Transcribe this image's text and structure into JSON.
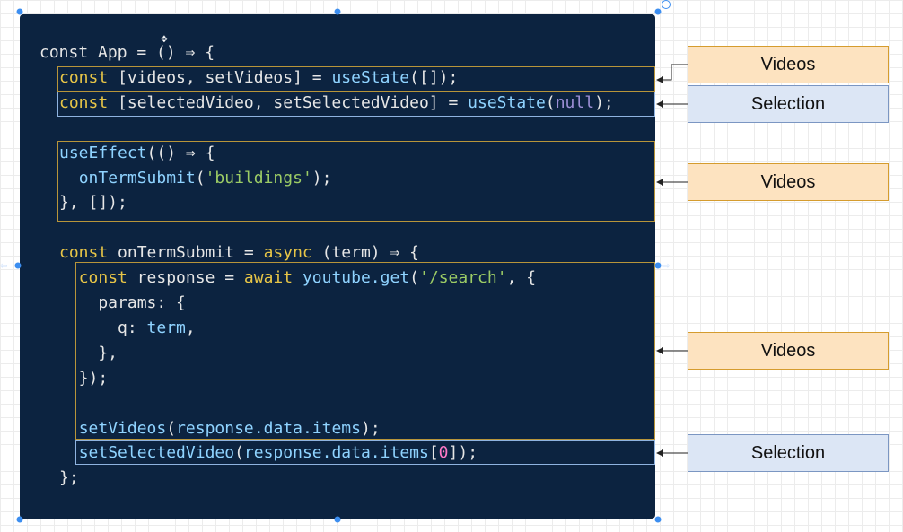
{
  "code": {
    "lines": [
      [
        {
          "t": "const App = () ⇒ {",
          "c": ""
        }
      ],
      [
        {
          "t": "const",
          "c": "kw"
        },
        {
          "t": " [videos, setVideos] = ",
          "c": ""
        },
        {
          "t": "useState",
          "c": "fn"
        },
        {
          "t": "([]);",
          "c": ""
        }
      ],
      [
        {
          "t": "const",
          "c": "kw"
        },
        {
          "t": " [selectedVideo, setSelectedVideo] = ",
          "c": ""
        },
        {
          "t": "useState",
          "c": "fn"
        },
        {
          "t": "(",
          "c": ""
        },
        {
          "t": "null",
          "c": "nul"
        },
        {
          "t": ");",
          "c": ""
        }
      ],
      [],
      [
        {
          "t": "useEffect",
          "c": "fn"
        },
        {
          "t": "(() ⇒ {",
          "c": ""
        }
      ],
      [
        {
          "t": "  ",
          "c": ""
        },
        {
          "t": "onTermSubmit",
          "c": "fn"
        },
        {
          "t": "(",
          "c": ""
        },
        {
          "t": "'buildings'",
          "c": "str"
        },
        {
          "t": ");",
          "c": ""
        }
      ],
      [
        {
          "t": "}, []);",
          "c": ""
        }
      ],
      [],
      [
        {
          "t": "const",
          "c": "kw"
        },
        {
          "t": " onTermSubmit = ",
          "c": ""
        },
        {
          "t": "async",
          "c": "kw"
        },
        {
          "t": " (term) ⇒ {",
          "c": ""
        }
      ],
      [
        {
          "t": "  ",
          "c": ""
        },
        {
          "t": "const",
          "c": "kw"
        },
        {
          "t": " response = ",
          "c": ""
        },
        {
          "t": "await",
          "c": "kw"
        },
        {
          "t": " ",
          "c": ""
        },
        {
          "t": "youtube.get",
          "c": "fn"
        },
        {
          "t": "(",
          "c": ""
        },
        {
          "t": "'/search'",
          "c": "str"
        },
        {
          "t": ", {",
          "c": ""
        }
      ],
      [
        {
          "t": "    params: {",
          "c": ""
        }
      ],
      [
        {
          "t": "      q: ",
          "c": ""
        },
        {
          "t": "term",
          "c": "fn"
        },
        {
          "t": ",",
          "c": ""
        }
      ],
      [
        {
          "t": "    },",
          "c": ""
        }
      ],
      [
        {
          "t": "  });",
          "c": ""
        }
      ],
      [],
      [
        {
          "t": "  ",
          "c": ""
        },
        {
          "t": "setVideos",
          "c": "fn"
        },
        {
          "t": "(",
          "c": ""
        },
        {
          "t": "response.data.items",
          "c": "fn"
        },
        {
          "t": ");",
          "c": ""
        }
      ],
      [
        {
          "t": "  ",
          "c": ""
        },
        {
          "t": "setSelectedVideo",
          "c": "fn"
        },
        {
          "t": "(",
          "c": ""
        },
        {
          "t": "response.data.items",
          "c": "fn"
        },
        {
          "t": "[",
          "c": ""
        },
        {
          "t": "0",
          "c": "num"
        },
        {
          "t": "]);",
          "c": ""
        }
      ],
      [
        {
          "t": "};",
          "c": ""
        }
      ]
    ]
  },
  "labels": {
    "videos_1": "Videos",
    "selection_1": "Selection",
    "videos_2": "Videos",
    "videos_3": "Videos",
    "selection_2": "Selection"
  },
  "colors": {
    "code_bg": "#0c2340",
    "keyword": "#e7c547",
    "function": "#8fd3ff",
    "string": "#9ccc65",
    "videos_fill": "#fde3c0",
    "selection_fill": "#dce6f5",
    "handle": "#3c8ef0"
  },
  "icons": [
    "move-cursor-icon",
    "rotate-handle-icon",
    "resize-handle-icon",
    "connector-arrow-icon"
  ]
}
